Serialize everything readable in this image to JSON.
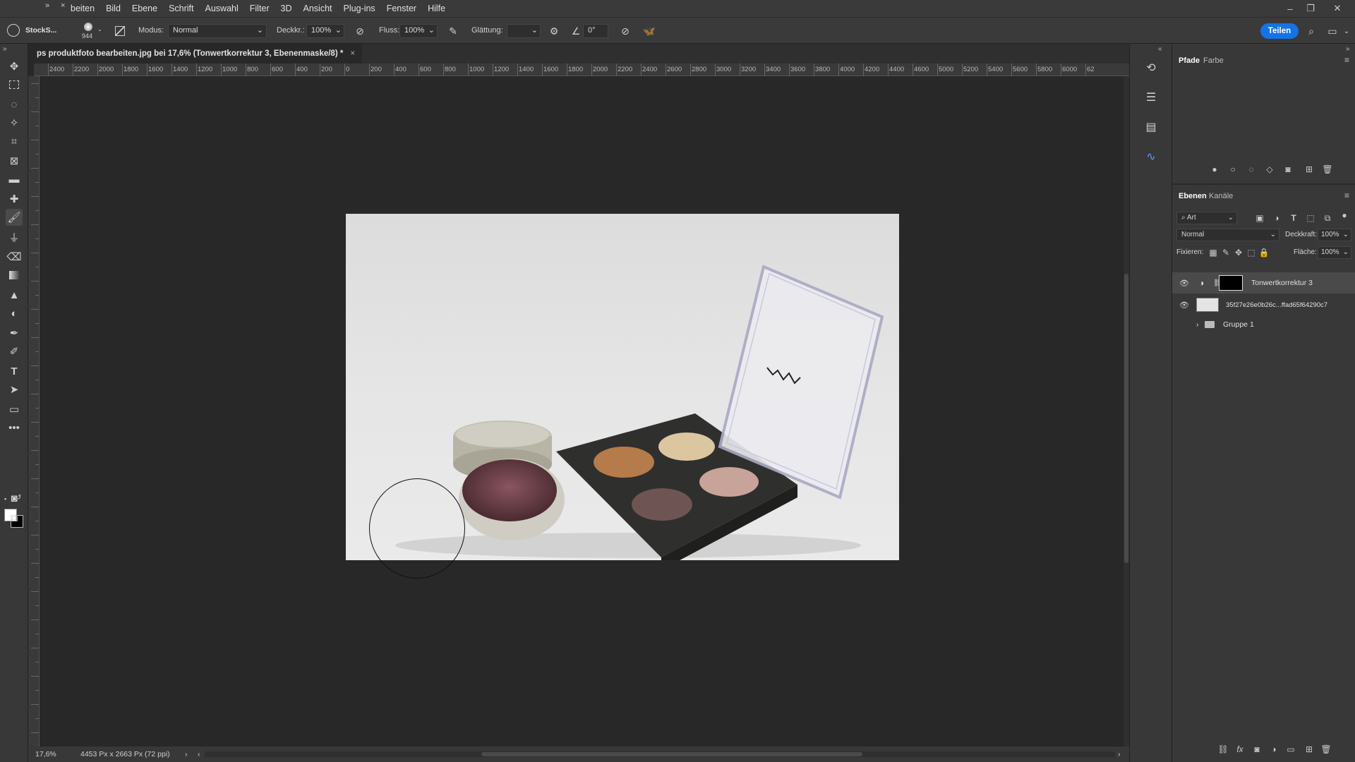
{
  "menubar": {
    "items": [
      "beiten",
      "Bild",
      "Ebene",
      "Schrift",
      "Auswahl",
      "Filter",
      "3D",
      "Ansicht",
      "Plug-ins",
      "Fenster",
      "Hilfe"
    ]
  },
  "options": {
    "app_label": "StockS...",
    "brush_size": "944",
    "modus_label": "Modus:",
    "modus_value": "Normal",
    "deckkraft_label": "Deckkr.:",
    "deckkraft_value": "100%",
    "fluss_label": "Fluss:",
    "fluss_value": "100%",
    "glaettung_label": "Glättung:",
    "glaettung_value": "",
    "angle_value": "0°",
    "share_label": "Teilen"
  },
  "document": {
    "tab_title": "ps produktfoto bearbeiten.jpg bei 17,6% (Tonwertkorrektur 3, Ebenenmaske/8) *",
    "zoom": "17,6%",
    "dimensions": "4453 Px x 2663 Px (72 ppi)"
  },
  "ruler": {
    "top_ticks": [
      "2400",
      "2200",
      "2000",
      "1800",
      "1600",
      "1400",
      "1200",
      "1000",
      "800",
      "600",
      "400",
      "200",
      "0",
      "200",
      "400",
      "600",
      "800",
      "1000",
      "1200",
      "1400",
      "1600",
      "1800",
      "2000",
      "2200",
      "2400",
      "2600",
      "2800",
      "3000",
      "3200",
      "3400",
      "3600",
      "3800",
      "4000",
      "4200",
      "4400",
      "4600",
      "5000",
      "5200",
      "5400",
      "5600",
      "5800",
      "6000",
      "62"
    ]
  },
  "panels": {
    "top_tabs": [
      "Pfade",
      "Farbe"
    ],
    "layers_tabs": [
      "Ebenen",
      "Kanäle"
    ],
    "filter_kind": "Art",
    "blend_mode": "Normal",
    "opacity_label": "Deckkraft:",
    "opacity_value": "100%",
    "lock_label": "Fixieren:",
    "fill_label": "Fläche:",
    "fill_value": "100%",
    "layers": [
      {
        "name": "Tonwertkorrektur 3",
        "visible": true,
        "selected": true
      },
      {
        "name": "35f27e26e0b26c...ffad65f64290c7",
        "visible": true,
        "selected": false
      },
      {
        "name": "Gruppe 1",
        "visible": false,
        "selected": false
      }
    ]
  },
  "colors": {
    "accent": "#1473e6",
    "ui_bg": "#383838",
    "canvas_bg": "#282828"
  }
}
